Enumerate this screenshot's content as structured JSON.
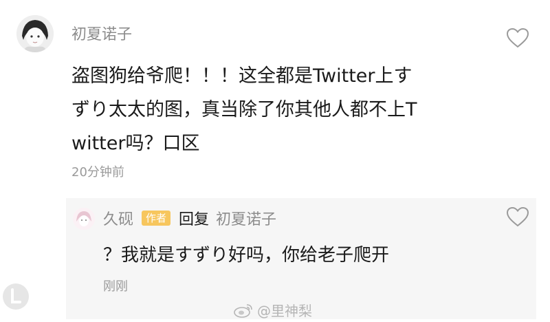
{
  "comment": {
    "username": "初夏诺子",
    "lines": [
      "盗图狗给爷爬！！！这全都是Twitter上す",
      "ずり太太的图，真当除了你其他人都不上T",
      "witter吗？口区"
    ],
    "time": "20分钟前",
    "like_icon": "heart-outline-icon"
  },
  "reply": {
    "username": "久砚",
    "badge": "作者",
    "reply_word": "回复",
    "reply_to": "初夏诺子",
    "text": "？我就是すずり好吗，你给老子爬开",
    "time": "刚刚",
    "like_icon": "heart-outline-icon"
  },
  "watermark": {
    "text": "@里神梨"
  },
  "colors": {
    "username": "#8c8c8c",
    "body_text": "#1a1a1a",
    "timestamp": "#9a9a9a",
    "reply_bg": "#f6f6f6",
    "author_badge": "#f7c65e"
  }
}
